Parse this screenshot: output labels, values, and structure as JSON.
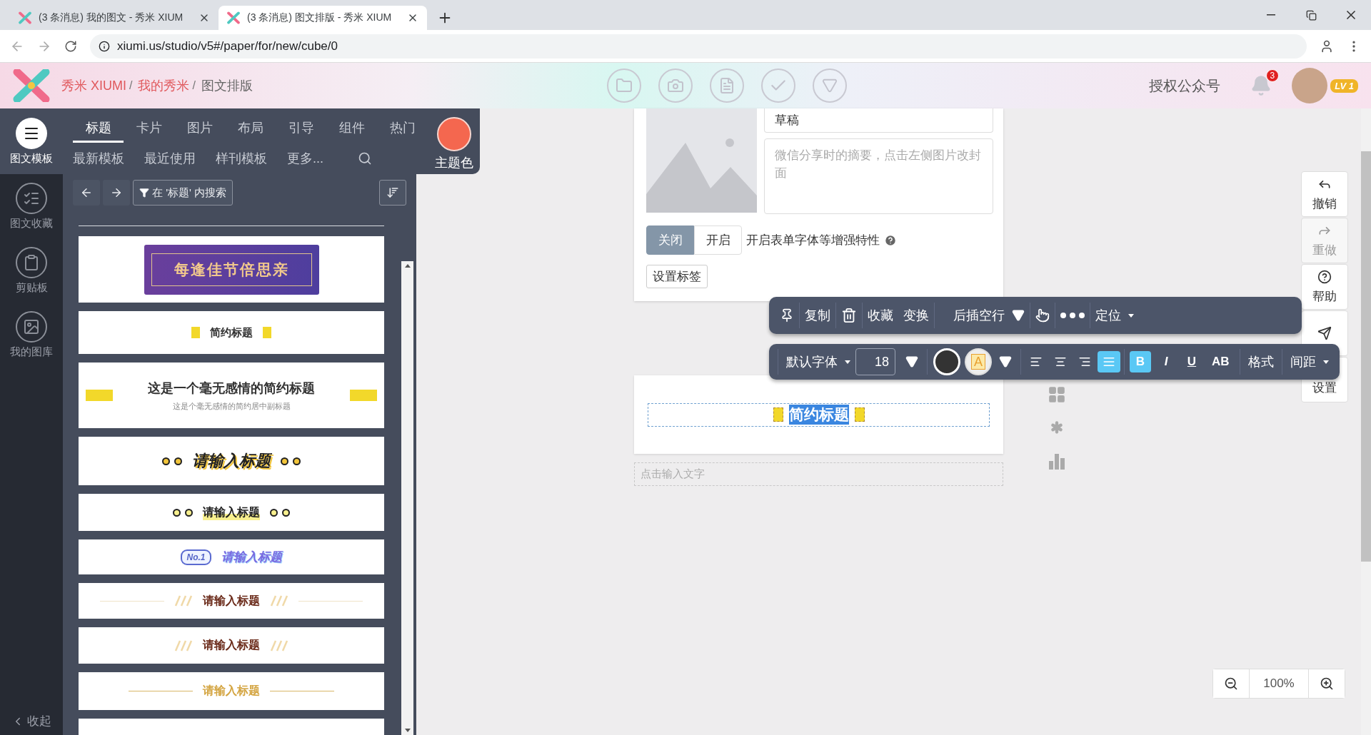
{
  "browser": {
    "tabs": [
      {
        "title": "(3 条消息) 我的图文 - 秀米 XIUM",
        "selected": false
      },
      {
        "title": "(3 条消息) 图文排版 - 秀米 XIUM",
        "selected": true
      }
    ],
    "url": "xiumi.us/studio/v5#/paper/for/new/cube/0"
  },
  "header": {
    "breadcrumbs": [
      {
        "label": "秀米 XIUMI",
        "kind": "link"
      },
      {
        "label": "我的秀米",
        "kind": "link"
      },
      {
        "label": "图文排版",
        "kind": "current"
      }
    ],
    "separators": [
      "/",
      "/"
    ],
    "auth": "授权公众号",
    "notifications": "3",
    "level": "LV 1"
  },
  "rail": {
    "items": [
      {
        "kind": "templates",
        "label": "图文模板",
        "selected": true
      },
      {
        "kind": "favorites",
        "label": "图文收藏",
        "selected": false
      },
      {
        "kind": "clipboard",
        "label": "剪贴板",
        "selected": false
      },
      {
        "kind": "gallery",
        "label": "我的图库",
        "selected": false
      }
    ],
    "collapse": "收起"
  },
  "panel": {
    "tabs": [
      {
        "label": "标题",
        "selected": true
      },
      {
        "label": "卡片",
        "selected": false
      },
      {
        "label": "图片",
        "selected": false
      },
      {
        "label": "布局",
        "selected": false
      },
      {
        "label": "引导",
        "selected": false
      },
      {
        "label": "组件",
        "selected": false
      },
      {
        "label": "热门",
        "selected": false
      }
    ],
    "subtabs": [
      "最新模板",
      "最近使用",
      "样刊模板",
      "更多..."
    ],
    "theme": "主题色",
    "search": "在 '标题' 内搜索",
    "templates": [
      {
        "kind": "banner",
        "title": "每逢佳节倍思亲"
      },
      {
        "kind": "bars",
        "title": "简约标题"
      },
      {
        "kind": "bars-wide",
        "title": "这是一个毫无感情的简约标题",
        "subtitle": "这是个毫无感情的简约居中副标题"
      },
      {
        "kind": "dots-italic",
        "title": "请输入标题"
      },
      {
        "kind": "dots",
        "title": "请输入标题"
      },
      {
        "kind": "badge",
        "badge": "No.1",
        "title": "请输入标题"
      },
      {
        "kind": "slashes-lines",
        "title": "请输入标题"
      },
      {
        "kind": "slashes",
        "title": "请输入标题"
      },
      {
        "kind": "lines-gold",
        "title": "请输入标题"
      },
      {
        "kind": "cut"
      }
    ]
  },
  "article": {
    "title": "草稿",
    "summary_placeholder": "微信分享时的摘要，点击左侧图片改封面",
    "toggle": [
      {
        "label": "关闭",
        "selected": true
      },
      {
        "label": "开启",
        "selected": false
      }
    ],
    "toggle_hint": "开启表单字体等增强特性",
    "tag_button": "设置标签"
  },
  "toolbar1": [
    {
      "kind": "pin"
    },
    {
      "kind": "text",
      "label": "复制"
    },
    {
      "kind": "trash"
    },
    {
      "kind": "text",
      "label": "收藏"
    },
    {
      "kind": "text",
      "label": "变换"
    },
    {
      "kind": "split",
      "label": "后插空行"
    },
    {
      "kind": "pointer"
    },
    {
      "kind": "more"
    },
    {
      "kind": "menu",
      "label": "定位"
    }
  ],
  "toolbar2": {
    "font": "默认字体",
    "size": "18",
    "highlight": "A",
    "align": [
      {
        "kind": "left",
        "selected": false
      },
      {
        "kind": "center",
        "selected": false
      },
      {
        "kind": "right",
        "selected": false
      },
      {
        "kind": "justify",
        "selected": true
      }
    ],
    "styles": [
      {
        "kind": "bold",
        "label": "B",
        "selected": true
      },
      {
        "kind": "italic",
        "label": "I",
        "selected": false
      },
      {
        "kind": "underline",
        "label": "U",
        "selected": false
      },
      {
        "kind": "case",
        "label": "AB",
        "selected": false
      }
    ],
    "format": "格式",
    "spacing": "间距"
  },
  "content": {
    "heading": "简约标题",
    "heading_selected": true,
    "placeholder": "点击输入文字"
  },
  "side_buttons": [
    {
      "kind": "undo",
      "label": "撤销",
      "disabled": false
    },
    {
      "kind": "redo",
      "label": "重做",
      "disabled": true
    },
    {
      "kind": "help",
      "label": "帮助",
      "disabled": false
    },
    {
      "kind": "send",
      "disabled": false
    },
    {
      "kind": "settings",
      "label": "设置",
      "disabled": false
    }
  ],
  "zoom": "100%"
}
